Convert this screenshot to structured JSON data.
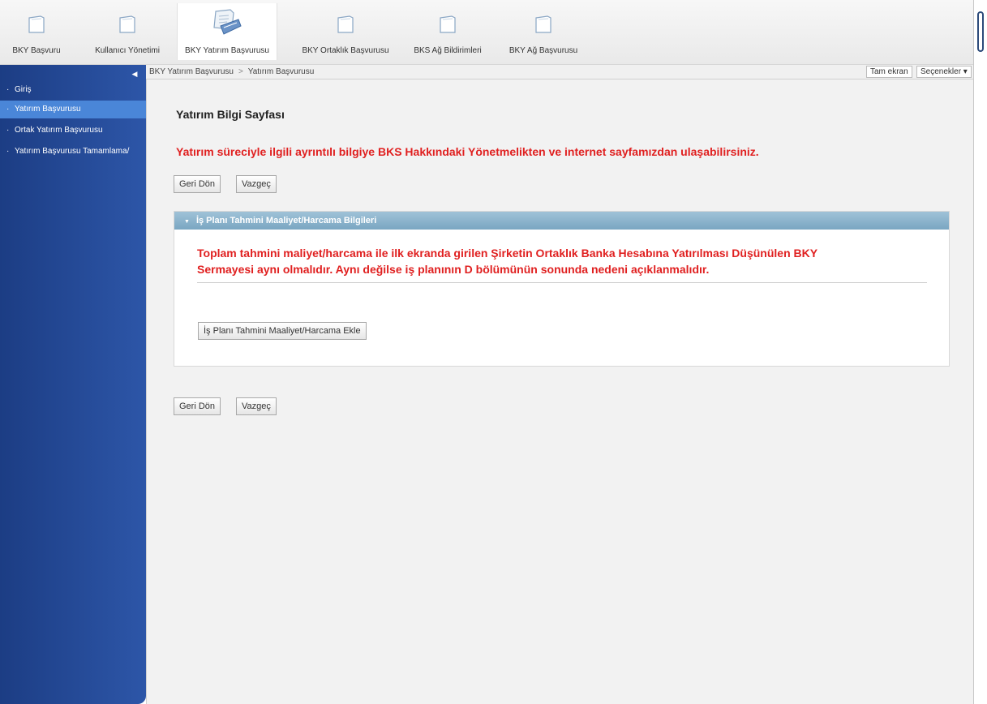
{
  "toolbar": {
    "items": [
      {
        "label": "BKY Başvuru",
        "icon": "folder-icon"
      },
      {
        "label": "Kullanıcı Yönetimi",
        "icon": "folder-icon"
      },
      {
        "label": "BKY Yatırım Başvurusu",
        "icon": "documents-icon",
        "active": true
      },
      {
        "label": "BKY Ortaklık Başvurusu",
        "icon": "folder-icon"
      },
      {
        "label": "BKS Ağ Bildirimleri",
        "icon": "folder-icon"
      },
      {
        "label": "BKY Ağ Başvurusu",
        "icon": "folder-icon"
      }
    ]
  },
  "sidebar": {
    "items": [
      {
        "label": "Giriş"
      },
      {
        "label": "Yatırım Başvurusu",
        "active": true
      },
      {
        "label": "Ortak Yatırım Başvurusu"
      },
      {
        "label": "Yatırım Başvurusu Tamamlama/"
      }
    ]
  },
  "breadcrumb": {
    "parent": "BKY Yatırım Başvurusu",
    "separator": ">",
    "current": "Yatırım Başvurusu"
  },
  "top_buttons": {
    "fullscreen": "Tam ekran",
    "options": "Seçenekler ▾"
  },
  "page": {
    "title": "Yatırım Bilgi Sayfası",
    "info": "Yatırım süreciyle ilgili ayrıntılı bilgiye BKS Hakkındaki Yönetmelikten ve internet sayfamızdan ulaşabilirsiniz.",
    "back_label": "Geri Dön",
    "cancel_label": "Vazgeç"
  },
  "panel": {
    "caret": "▼",
    "title": "İş Planı Tahmini Maaliyet/Harcama Bilgileri",
    "warning_line1": "Toplam tahmini maliyet/harcama ile ilk ekranda girilen Şirketin Ortaklık Banka Hesabına Yatırılması Düşünülen BKY",
    "warning_line2": "Sermayesi aynı olmalıdır. Aynı değilse iş planının D bölümünün sonunda nedeni açıklanmalıdır.",
    "add_label": "İş Planı Tahmini Maaliyet/Harcama Ekle"
  },
  "colors": {
    "sidebar": "#1c3d84",
    "sidebar_active": "#4a86d8",
    "warning_text": "#e02020",
    "panel_header": "#8ab3cd"
  }
}
